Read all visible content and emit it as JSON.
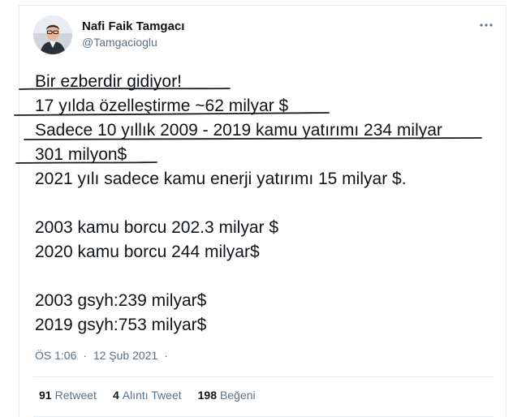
{
  "author": {
    "name": "Nafi Faik Tamgacı",
    "handle": "@Tamgacioglu"
  },
  "tweet": {
    "lines": [
      "Bir ezberdir gidiyor!",
      "17 yılda özelleştirme ~62 milyar $",
      "Sadece 10 yıllık 2009 - 2019 kamu yatırımı 234 milyar",
      "301 milyon$",
      "2021 yılı sadece kamu enerji yatırımı 15 milyar $.",
      "",
      "2003 kamu borcu 202.3 milyar $",
      "2020 kamu borcu 244 milyar$",
      "",
      "2003 gsyh:239 milyar$",
      "2019 gsyh:753 milyar$"
    ]
  },
  "meta": {
    "time": "ÖS 1:06",
    "separator": "·",
    "date": "12 Şub 2021",
    "trailing": "·"
  },
  "stats": {
    "retweets": {
      "count": "91",
      "label": "Retweet"
    },
    "quotes": {
      "count": "4",
      "label": "Alıntı Tweet"
    },
    "likes": {
      "count": "198",
      "label": "Beğeni"
    }
  },
  "colors": {
    "text": "#0f1419",
    "secondary": "#5b7083",
    "border": "#e6ecf0",
    "handwritten_underline": "#1c1c1c"
  },
  "icons": {
    "more": "more-dots-icon",
    "avatar": "avatar-photo"
  }
}
